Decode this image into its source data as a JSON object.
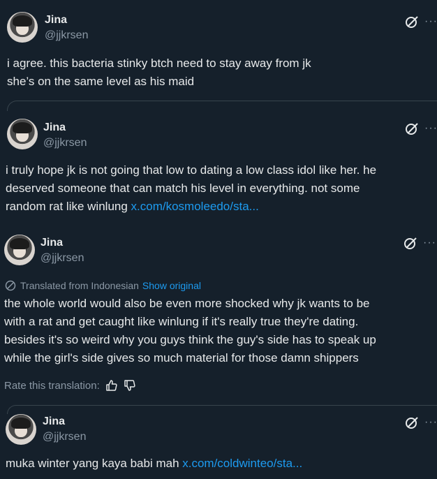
{
  "posts": [
    {
      "name": "Jina",
      "handle": "@jjkrsen",
      "text_lines": [
        "i agree. this bacteria stinky btch need to stay away from jk",
        "she’s on the same level as his maid"
      ]
    },
    {
      "name": "Jina",
      "handle": "@jjkrsen",
      "text_lines": [
        "i truly hope jk is not going that low to dating a low class idol like her. he",
        "deserved someone that can match his level in everything. not some",
        "random rat like winlung "
      ],
      "link": "x.com/kosmoleedo/sta..."
    },
    {
      "name": "Jina",
      "handle": "@jjkrsen",
      "translated_label": "Translated from Indonesian",
      "show_original": "Show original",
      "text_lines": [
        "the whole world would also be even more shocked why jk wants to be",
        "with a rat and get caught like winlung if it's really true they're dating.",
        "besides it's so weird why you guys think the guy's side has to speak up",
        "while the girl's side gives so much material for those damn shippers"
      ],
      "rate_label": "Rate this translation:"
    },
    {
      "name": "Jina",
      "handle": "@jjkrsen",
      "text_lines": [
        "muka winter yang kaya babi mah "
      ],
      "link": "x.com/coldwinteo/sta..."
    }
  ],
  "icons": {
    "grok": "grok-icon",
    "more": "more-icon",
    "thumbs_up": "thumbs-up-icon",
    "thumbs_down": "thumbs-down-icon",
    "translate": "translate-icon"
  },
  "colors": {
    "background": "#15202b",
    "text": "#e7e9ea",
    "secondary": "#8b98a5",
    "link": "#1d9bf0"
  }
}
